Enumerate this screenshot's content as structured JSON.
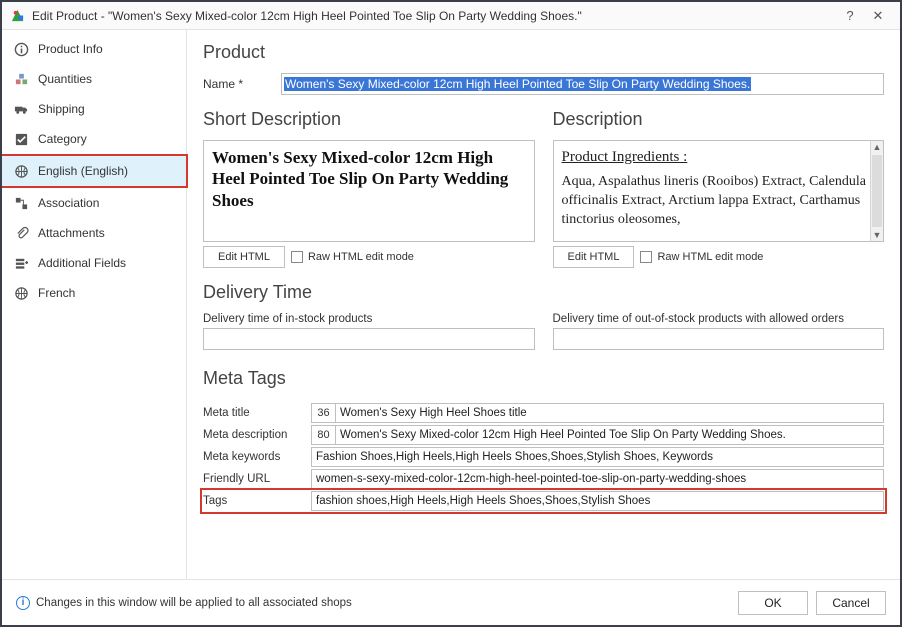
{
  "window": {
    "title": "Edit Product - \"Women's Sexy Mixed-color 12cm High Heel Pointed Toe Slip On Party Wedding Shoes.\""
  },
  "sidebar": {
    "items": [
      {
        "label": "Product Info",
        "icon": "info-icon"
      },
      {
        "label": "Quantities",
        "icon": "boxes-icon"
      },
      {
        "label": "Shipping",
        "icon": "truck-icon"
      },
      {
        "label": "Category",
        "icon": "check-icon"
      },
      {
        "label": "English (English)",
        "icon": "globe-icon",
        "selected": true
      },
      {
        "label": "Association",
        "icon": "assoc-icon"
      },
      {
        "label": "Attachments",
        "icon": "paperclip-icon"
      },
      {
        "label": "Additional Fields",
        "icon": "fields-icon"
      },
      {
        "label": "French",
        "icon": "globe-icon"
      }
    ]
  },
  "product": {
    "heading": "Product",
    "name_label": "Name *",
    "name_value": "Women's Sexy Mixed-color 12cm High Heel Pointed Toe Slip On Party Wedding Shoes."
  },
  "short_desc": {
    "heading": "Short Description",
    "content": "Women's Sexy Mixed-color 12cm High Heel Pointed Toe Slip On Party Wedding Shoes",
    "edit_btn": "Edit HTML",
    "raw_lbl": "Raw HTML edit mode"
  },
  "long_desc": {
    "heading": "Description",
    "ingr_title": "Product Ingredients :",
    "content": "Aqua, Aspalathus lineris (Rooibos) Extract, Calendula officinalis Extract, Arctium lappa Extract, Carthamus tinctorius oleosomes,",
    "edit_btn": "Edit HTML",
    "raw_lbl": "Raw HTML edit mode"
  },
  "delivery": {
    "heading": "Delivery Time",
    "in_stock_lbl": "Delivery time of in-stock products",
    "oos_lbl": "Delivery time of out-of-stock products with allowed orders",
    "in_stock_val": "",
    "oos_val": ""
  },
  "meta": {
    "heading": "Meta Tags",
    "title_lbl": "Meta title",
    "title_count": "36",
    "title_val": "Women's Sexy High Heel Shoes title",
    "desc_lbl": "Meta description",
    "desc_count": "80",
    "desc_val": "Women's Sexy Mixed-color 12cm High Heel Pointed Toe Slip On Party Wedding Shoes.",
    "kw_lbl": "Meta keywords",
    "kw_val": "Fashion Shoes,High Heels,High Heels Shoes,Shoes,Stylish Shoes, Keywords",
    "url_lbl": "Friendly URL",
    "url_val": "women-s-sexy-mixed-color-12cm-high-heel-pointed-toe-slip-on-party-wedding-shoes",
    "tags_lbl": "Tags",
    "tags_val": "fashion shoes,High Heels,High Heels Shoes,Shoes,Stylish Shoes"
  },
  "footer": {
    "note": "Changes in this window will be applied to all associated shops",
    "ok": "OK",
    "cancel": "Cancel"
  }
}
